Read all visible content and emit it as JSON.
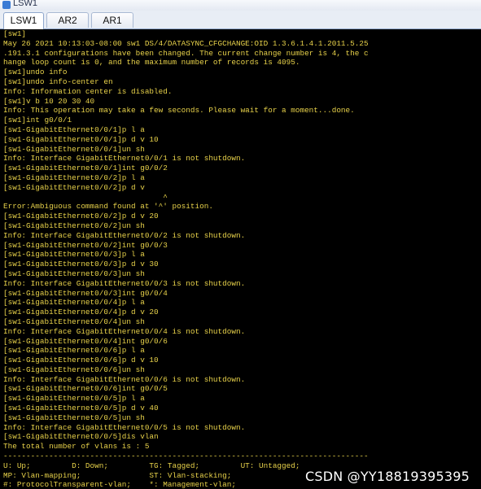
{
  "window": {
    "title": "LSW1"
  },
  "tabs": [
    {
      "label": "LSW1",
      "active": true
    },
    {
      "label": "AR2",
      "active": false
    },
    {
      "label": "AR1",
      "active": false
    }
  ],
  "terminal": {
    "text_color": "#e8d24a",
    "lines": [
      "[sw1]",
      "May 26 2021 10:13:03-08:00 sw1 DS/4/DATASYNC_CFGCHANGE:OID 1.3.6.1.4.1.2011.5.25",
      ".191.3.1 configurations have been changed. The current change number is 4, the c",
      "hange loop count is 0, and the maximum number of records is 4095.",
      "[sw1]undo info",
      "[sw1]undo info-center en",
      "Info: Information center is disabled.",
      "[sw1]v b 10 20 30 40",
      "Info: This operation may take a few seconds. Please wait for a moment...done.",
      "[sw1]int g0/0/1",
      "[sw1-GigabitEthernet0/0/1]p l a",
      "[sw1-GigabitEthernet0/0/1]p d v 10",
      "[sw1-GigabitEthernet0/0/1]un sh",
      "Info: Interface GigabitEthernet0/0/1 is not shutdown.",
      "[sw1-GigabitEthernet0/0/1]int g0/0/2",
      "[sw1-GigabitEthernet0/0/2]p l a",
      "[sw1-GigabitEthernet0/0/2]p d v",
      "                                   ^",
      "Error:Ambiguous command found at '^' position.",
      "[sw1-GigabitEthernet0/0/2]p d v 20",
      "[sw1-GigabitEthernet0/0/2]un sh",
      "Info: Interface GigabitEthernet0/0/2 is not shutdown.",
      "[sw1-GigabitEthernet0/0/2]int g0/0/3",
      "[sw1-GigabitEthernet0/0/3]p l a",
      "[sw1-GigabitEthernet0/0/3]p d v 30",
      "[sw1-GigabitEthernet0/0/3]un sh",
      "Info: Interface GigabitEthernet0/0/3 is not shutdown.",
      "[sw1-GigabitEthernet0/0/3]int g0/0/4",
      "[sw1-GigabitEthernet0/0/4]p l a",
      "[sw1-GigabitEthernet0/0/4]p d v 20",
      "[sw1-GigabitEthernet0/0/4]un sh",
      "Info: Interface GigabitEthernet0/0/4 is not shutdown.",
      "[sw1-GigabitEthernet0/0/4]int g0/0/6",
      "[sw1-GigabitEthernet0/0/6]p l a",
      "[sw1-GigabitEthernet0/0/6]p d v 10",
      "[sw1-GigabitEthernet0/0/6]un sh",
      "Info: Interface GigabitEthernet0/0/6 is not shutdown.",
      "[sw1-GigabitEthernet0/0/6]int g0/0/5",
      "[sw1-GigabitEthernet0/0/5]p l a",
      "[sw1-GigabitEthernet0/0/5]p d v 40",
      "[sw1-GigabitEthernet0/0/5]un sh",
      "Info: Interface GigabitEthernet0/0/5 is not shutdown.",
      "[sw1-GigabitEthernet0/0/5]dis vlan",
      "The total number of vlans is : 5",
      "--------------------------------------------------------------------------------",
      "U: Up;         D: Down;         TG: Tagged;         UT: Untagged;",
      "MP: Vlan-mapping;               ST: Vlan-stacking;",
      "#: ProtocolTransparent-vlan;    *: Management-vlan;"
    ]
  },
  "watermark": "CSDN @YY18819395395"
}
